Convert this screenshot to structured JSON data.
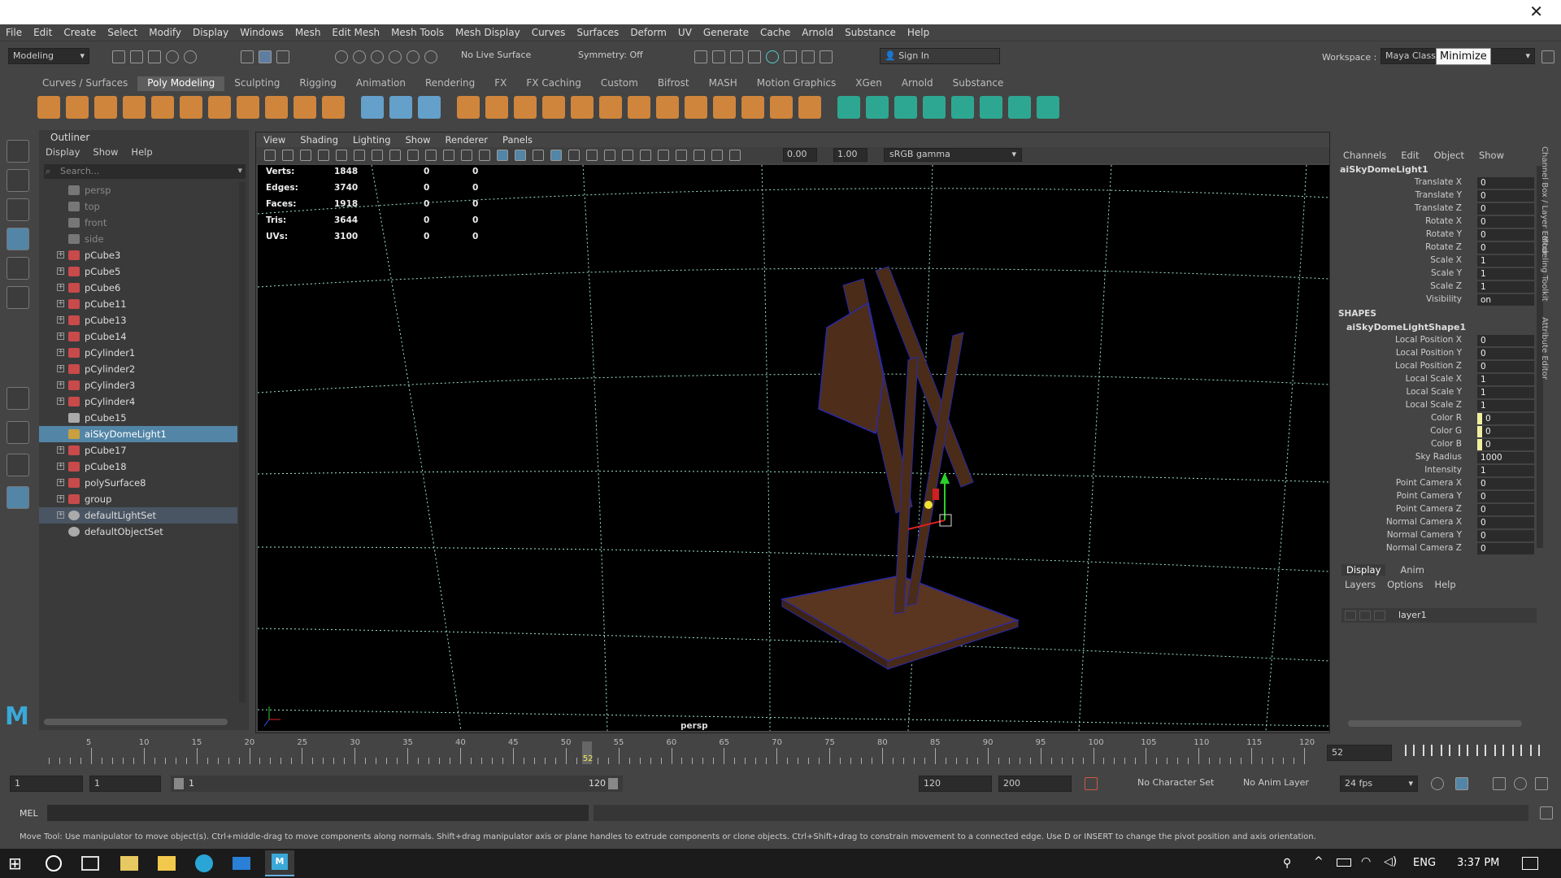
{
  "window": {
    "close_glyph": "✕"
  },
  "menubar": [
    "File",
    "Edit",
    "Create",
    "Select",
    "Modify",
    "Display",
    "Windows",
    "Mesh",
    "Edit Mesh",
    "Mesh Tools",
    "Mesh Display",
    "Curves",
    "Surfaces",
    "Deform",
    "UV",
    "Generate",
    "Cache",
    "Arnold",
    "Substance",
    "Help"
  ],
  "statusline": {
    "menuset": "Modeling",
    "live_surface": "No Live Surface",
    "symmetry": "Symmetry: Off",
    "signin": "Sign In",
    "workspace_label": "Workspace :",
    "workspace_value": "Maya Classic",
    "tooltip": "Minimize"
  },
  "shelf_tabs": [
    "Curves / Surfaces",
    "Poly Modeling",
    "Sculpting",
    "Rigging",
    "Animation",
    "Rendering",
    "FX",
    "FX Caching",
    "Custom",
    "Bifrost",
    "MASH",
    "Motion Graphics",
    "XGen",
    "Arnold",
    "Substance"
  ],
  "shelf_active": "Poly Modeling",
  "outliner": {
    "title": "Outliner",
    "menu": [
      "Display",
      "Show",
      "Help"
    ],
    "search_placeholder": "Search...",
    "items": [
      {
        "label": "persp",
        "kind": "camera",
        "dim": true,
        "exp": false
      },
      {
        "label": "top",
        "kind": "camera",
        "dim": true,
        "exp": false
      },
      {
        "label": "front",
        "kind": "camera",
        "dim": true,
        "exp": false
      },
      {
        "label": "side",
        "kind": "camera",
        "dim": true,
        "exp": false
      },
      {
        "label": "pCube3",
        "kind": "mesh",
        "dim": false,
        "exp": true
      },
      {
        "label": "pCube5",
        "kind": "mesh",
        "dim": false,
        "exp": true
      },
      {
        "label": "pCube6",
        "kind": "mesh",
        "dim": false,
        "exp": true
      },
      {
        "label": "pCube11",
        "kind": "mesh",
        "dim": false,
        "exp": true
      },
      {
        "label": "pCube13",
        "kind": "mesh",
        "dim": false,
        "exp": true
      },
      {
        "label": "pCube14",
        "kind": "mesh",
        "dim": false,
        "exp": true
      },
      {
        "label": "pCylinder1",
        "kind": "mesh",
        "dim": false,
        "exp": true
      },
      {
        "label": "pCylinder2",
        "kind": "mesh",
        "dim": false,
        "exp": true
      },
      {
        "label": "pCylinder3",
        "kind": "mesh",
        "dim": false,
        "exp": true
      },
      {
        "label": "pCylinder4",
        "kind": "mesh",
        "dim": false,
        "exp": true
      },
      {
        "label": "pCube15",
        "kind": "transform",
        "dim": false,
        "exp": false
      },
      {
        "label": "aiSkyDomeLight1",
        "kind": "light",
        "dim": false,
        "exp": false,
        "selected": true
      },
      {
        "label": "pCube17",
        "kind": "mesh",
        "dim": false,
        "exp": true
      },
      {
        "label": "pCube18",
        "kind": "mesh",
        "dim": false,
        "exp": true
      },
      {
        "label": "polySurface8",
        "kind": "mesh",
        "dim": false,
        "exp": true
      },
      {
        "label": "group",
        "kind": "mesh",
        "dim": false,
        "exp": true
      },
      {
        "label": "defaultLightSet",
        "kind": "set",
        "dim": false,
        "exp": true,
        "highlight": true
      },
      {
        "label": "defaultObjectSet",
        "kind": "set",
        "dim": false,
        "exp": false
      }
    ]
  },
  "viewport": {
    "menu": [
      "View",
      "Shading",
      "Lighting",
      "Show",
      "Renderer",
      "Panels"
    ],
    "field_a": "0.00",
    "field_b": "1.00",
    "colorspace": "sRGB gamma",
    "camera_label": "persp",
    "hud": [
      {
        "label": "Verts:",
        "v1": "1848",
        "v2": "0",
        "v3": "0"
      },
      {
        "label": "Edges:",
        "v1": "3740",
        "v2": "0",
        "v3": "0"
      },
      {
        "label": "Faces:",
        "v1": "1918",
        "v2": "0",
        "v3": "0"
      },
      {
        "label": "Tris:",
        "v1": "3644",
        "v2": "0",
        "v3": "0"
      },
      {
        "label": "UVs:",
        "v1": "3100",
        "v2": "0",
        "v3": "0"
      }
    ]
  },
  "channelbox": {
    "menu": [
      "Channels",
      "Edit",
      "Object",
      "Show"
    ],
    "object": "aiSkyDomeLight1",
    "transform": [
      {
        "label": "Translate X",
        "value": "0"
      },
      {
        "label": "Translate Y",
        "value": "0"
      },
      {
        "label": "Translate Z",
        "value": "0"
      },
      {
        "label": "Rotate X",
        "value": "0"
      },
      {
        "label": "Rotate Y",
        "value": "0"
      },
      {
        "label": "Rotate Z",
        "value": "0"
      },
      {
        "label": "Scale X",
        "value": "1"
      },
      {
        "label": "Scale Y",
        "value": "1"
      },
      {
        "label": "Scale Z",
        "value": "1"
      },
      {
        "label": "Visibility",
        "value": "on"
      }
    ],
    "shapes_header": "SHAPES",
    "shape_name": "aiSkyDomeLightShape1",
    "shape": [
      {
        "label": "Local Position X",
        "value": "0"
      },
      {
        "label": "Local Position Y",
        "value": "0"
      },
      {
        "label": "Local Position Z",
        "value": "0"
      },
      {
        "label": "Local Scale X",
        "value": "1"
      },
      {
        "label": "Local Scale Y",
        "value": "1"
      },
      {
        "label": "Local Scale Z",
        "value": "1"
      },
      {
        "label": "Color R",
        "value": "0"
      },
      {
        "label": "Color G",
        "value": "0"
      },
      {
        "label": "Color B",
        "value": "0"
      },
      {
        "label": "Sky Radius",
        "value": "1000"
      },
      {
        "label": "Intensity",
        "value": "1"
      },
      {
        "label": "Point Camera X",
        "value": "0"
      },
      {
        "label": "Point Camera Y",
        "value": "0"
      },
      {
        "label": "Point Camera Z",
        "value": "0"
      },
      {
        "label": "Normal Camera X",
        "value": "0"
      },
      {
        "label": "Normal Camera Y",
        "value": "0"
      },
      {
        "label": "Normal Camera Z",
        "value": "0"
      }
    ],
    "side_tabs": [
      "Channel Box / Layer Editor",
      "Modeling Toolkit",
      "Attribute Editor"
    ]
  },
  "layers": {
    "tabs": [
      "Display",
      "Anim"
    ],
    "menu": [
      "Layers",
      "Options",
      "Help"
    ],
    "layer": "layer1"
  },
  "timeslider": {
    "ticks": [
      "5",
      "10",
      "15",
      "20",
      "25",
      "30",
      "35",
      "40",
      "45",
      "50",
      "55",
      "60",
      "65",
      "70",
      "75",
      "80",
      "85",
      "90",
      "95",
      "100",
      "105",
      "110",
      "115",
      "120"
    ],
    "current_marker": "52",
    "current_field": "52"
  },
  "rangeslider": {
    "start": "1",
    "start2": "1",
    "range_start": "1",
    "range_end": "120",
    "end": "120",
    "end2": "200",
    "character_set": "No Character Set",
    "anim_layer": "No Anim Layer",
    "fps": "24 fps"
  },
  "cmdline": {
    "label": "MEL"
  },
  "helpline": {
    "text": "Move Tool: Use manipulator to move object(s). Ctrl+middle-drag to move components along normals. Shift+drag manipulator axis or plane handles to extrude components or clone objects. Ctrl+Shift+drag to constrain movement to a connected edge. Use D or INSERT to change the pivot position and axis orientation."
  },
  "taskbar": {
    "lang": "ENG",
    "time": "3:37 PM"
  },
  "colors": {
    "accent": "#5285a6",
    "grid": "#9fe8c8",
    "wood": "#5a3520"
  }
}
